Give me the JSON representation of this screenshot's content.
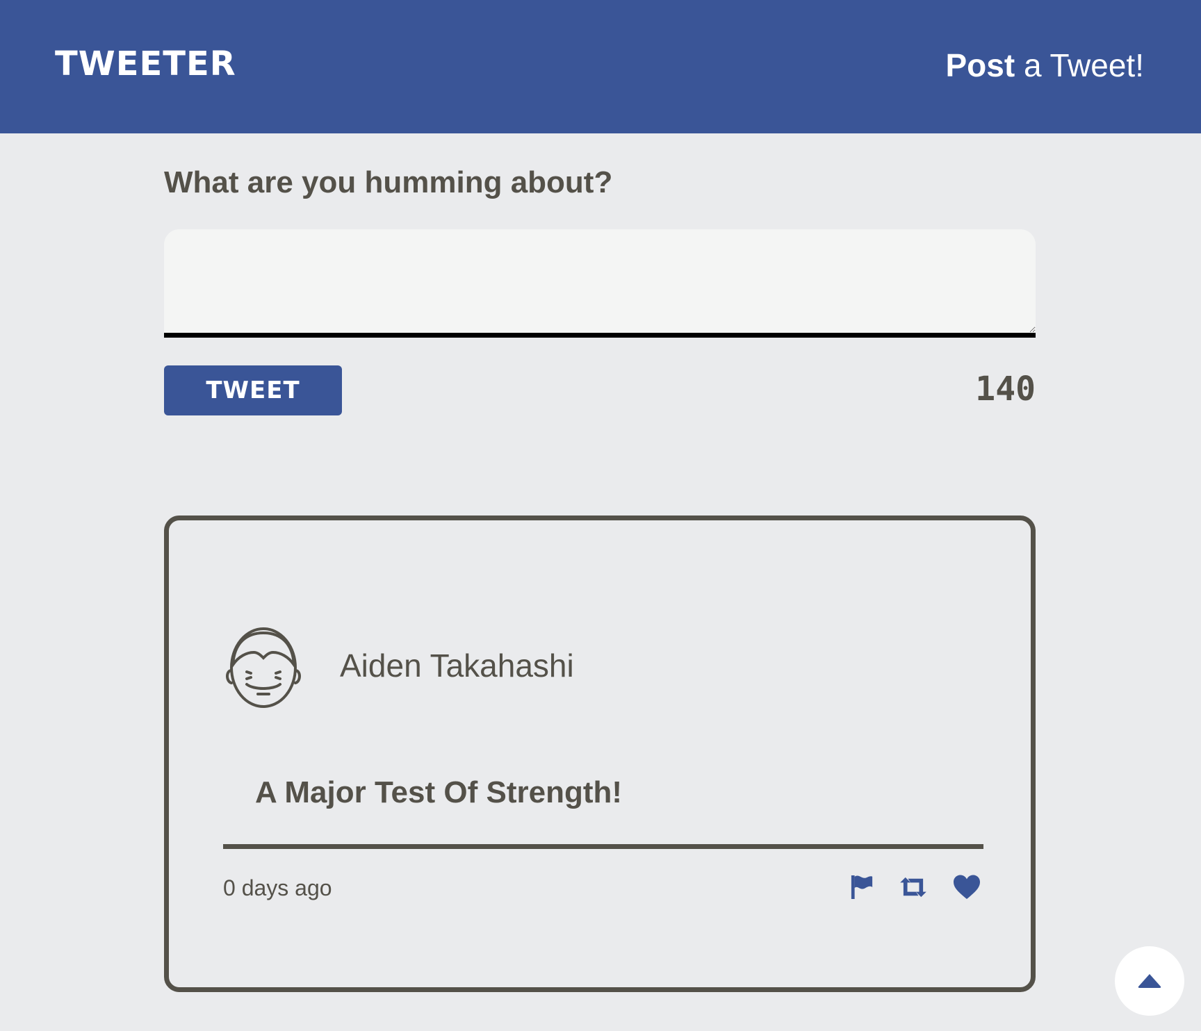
{
  "navbar": {
    "brand": "TWEETER",
    "compose_bold": "Post",
    "compose_rest": " a Tweet!"
  },
  "composer": {
    "heading": "What are you humming about?",
    "input_value": "",
    "button_label": "TWEET",
    "char_counter": "140"
  },
  "tweets": [
    {
      "author": "Aiden Takahashi",
      "content": "A Major Test Of Strength!",
      "timestamp": "0 days ago",
      "actions": [
        "flag-icon",
        "retweet-icon",
        "heart-icon"
      ]
    }
  ],
  "scroll_top": {
    "icon": "caret-up-icon"
  },
  "colors": {
    "brand_blue": "#3a5597",
    "text": "#545149",
    "background": "#eaebed",
    "input_bg": "#f4f5f4"
  }
}
